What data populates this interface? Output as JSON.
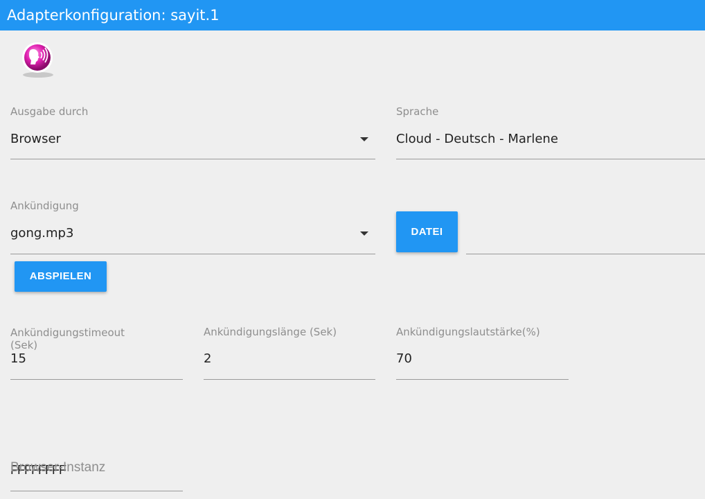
{
  "window": {
    "title": "Adapterkonfiguration: sayit.1"
  },
  "logo": {
    "icon": "speaking-head-icon"
  },
  "colors": {
    "accent": "#2196f3",
    "background": "#efefef",
    "logo": "#e020b0"
  },
  "fields": {
    "output": {
      "label": "Ausgabe durch",
      "value": "Browser"
    },
    "language": {
      "label": "Sprache",
      "value": "Cloud - Deutsch - Marlene"
    },
    "announce": {
      "label": "Ankündigung",
      "value": "gong.mp3"
    },
    "file": {
      "value": ""
    },
    "announce_timeout": {
      "label": "Ankündigungstimeout (Sek)",
      "value": "15"
    },
    "announce_length": {
      "label": "Ankündigungslänge (Sek)",
      "value": "2"
    },
    "announce_volume": {
      "label": "Ankündigungslautstärke(%)",
      "value": "70"
    },
    "browser_instance": {
      "label": "Browser-Instanz",
      "value": "FFFFFFFF"
    }
  },
  "buttons": {
    "file": "DATEI",
    "play": "ABSPIELEN"
  }
}
